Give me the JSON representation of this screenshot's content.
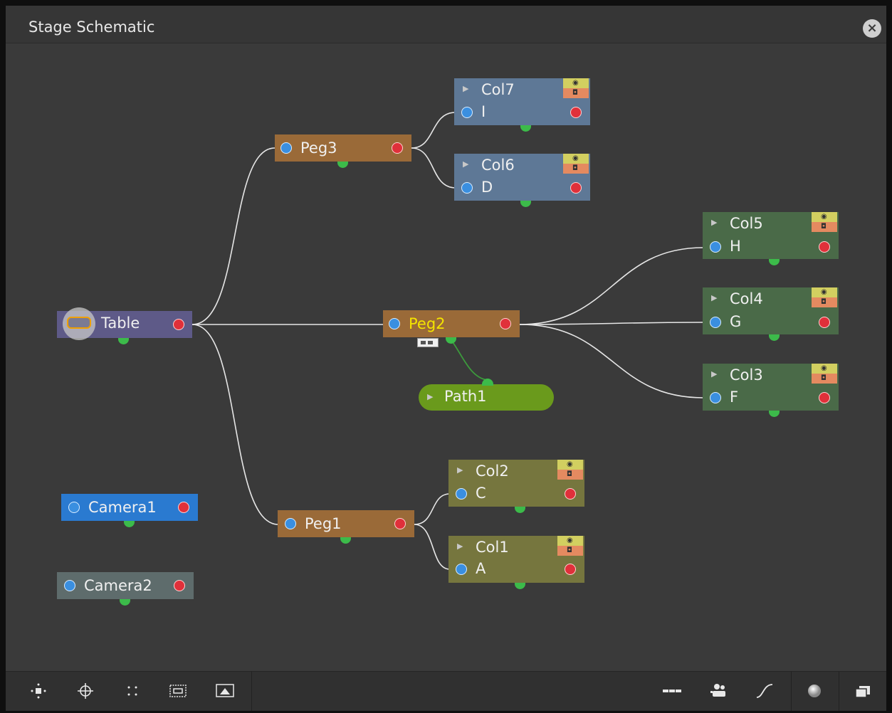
{
  "window": {
    "title": "Stage Schematic",
    "close_icon": "close-icon"
  },
  "nodes": {
    "table": {
      "name": "Table"
    },
    "camera1": {
      "name": "Camera1"
    },
    "camera2": {
      "name": "Camera2"
    },
    "peg1": {
      "name": "Peg1"
    },
    "peg2": {
      "name": "Peg2"
    },
    "peg3": {
      "name": "Peg3"
    },
    "path1": {
      "name": "Path1"
    },
    "col1": {
      "name": "Col1",
      "sub": "A"
    },
    "col2": {
      "name": "Col2",
      "sub": "C"
    },
    "col3": {
      "name": "Col3",
      "sub": "F"
    },
    "col4": {
      "name": "Col4",
      "sub": "G"
    },
    "col5": {
      "name": "Col5",
      "sub": "H"
    },
    "col6": {
      "name": "Col6",
      "sub": "D"
    },
    "col7": {
      "name": "Col7",
      "sub": "I"
    }
  },
  "colors": {
    "peg": "#9a6a38",
    "table": "#5e5a88",
    "camera_active": "#2a7ad0",
    "camera_inactive": "#5e6c6c",
    "column_blue": "#5e7896",
    "column_green": "#4a6a48",
    "column_olive": "#76763e",
    "path": "#6a9a1c",
    "current_node_text": "#f4e400"
  },
  "toolbar": {
    "left": [
      "fit-to-window-icon",
      "focus-current-icon",
      "reorder-nodes-icon",
      "normal-size-icon",
      "toggle-node-icons-icon"
    ],
    "right": [
      "minimize-nodes-icon",
      "output-icon",
      "spline-icon",
      "toggle-fx-stage-icon",
      "schematic-menu-icon"
    ]
  }
}
